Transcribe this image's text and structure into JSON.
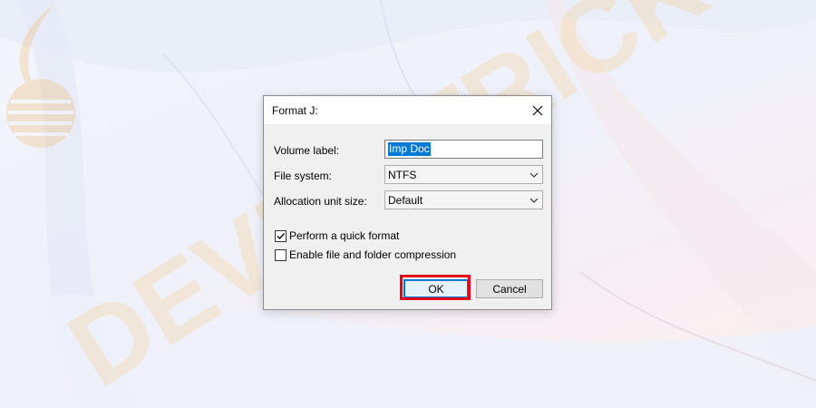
{
  "dialog": {
    "title": "Format J:",
    "volume_label": {
      "label": "Volume label:",
      "value": "Imp Doc"
    },
    "file_system": {
      "label": "File system:",
      "selected": "NTFS"
    },
    "allocation_unit": {
      "label": "Allocation unit size:",
      "selected": "Default"
    },
    "quick_format": {
      "label": "Perform a quick format",
      "checked": true
    },
    "compression": {
      "label": "Enable file and folder compression",
      "checked": false
    },
    "ok_label": "OK",
    "cancel_label": "Cancel"
  },
  "watermark": {
    "text": "DEVICETRICKS",
    "color": "#f7c46a"
  },
  "colors": {
    "highlight": "#e3001b",
    "selection": "#0078d7"
  }
}
